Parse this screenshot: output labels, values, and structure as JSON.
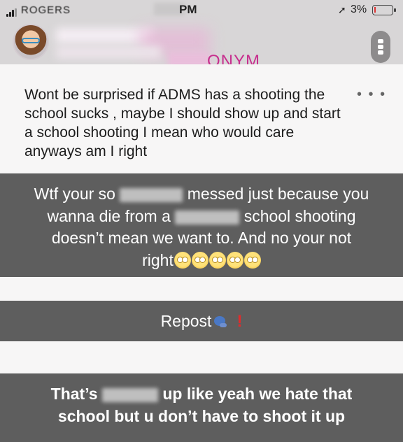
{
  "status_bar": {
    "carrier": "ROGERS",
    "time": "PM",
    "battery": "3%",
    "icons": [
      "signal-icon",
      "location-icon",
      "battery-icon"
    ]
  },
  "header": {
    "title": "ONYM",
    "icons": [
      "avatar",
      "more-icon"
    ]
  },
  "post": {
    "text": "Wont be surprised if ADMS has a shooting the school sucks , maybe I should show up and start a school shooting I mean who would care anyways am I right",
    "more_icon_glyph": "• • •"
  },
  "replies": {
    "reply1": {
      "line1_a": "Wtf your so",
      "line1_b": "messed just because you",
      "line2_a": "wanna die from a",
      "line2_b": "school shooting",
      "line3": "doesn’t mean we want to. And no your not",
      "line4": "right",
      "emoji_icon": "face-with-rolling-eyes-icon"
    },
    "reply2": {
      "text": "Repost",
      "icons": [
        "speaker-icon",
        "exclamation-icon"
      ],
      "exclaim_glyph": "!"
    },
    "reply3": {
      "line1_a": "That’s",
      "line1_b": "up like yeah we hate that",
      "line2": "school but u don’t have to shoot it up"
    }
  },
  "colors": {
    "background": "#e9e7e8",
    "white_band": "#f7f6f6",
    "gray_band": "#5e5e5e",
    "accent": "#c72f8e"
  }
}
